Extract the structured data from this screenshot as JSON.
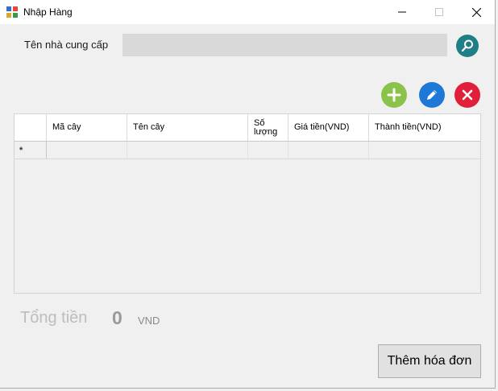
{
  "window": {
    "title": "Nhập Hàng",
    "minimize_glyph": "—",
    "maximize_glyph": "☐",
    "close_glyph": "✕"
  },
  "supplier": {
    "label": "Tên nhà cung cấp",
    "value": "",
    "placeholder": ""
  },
  "toolbar": {
    "search_icon": "search-icon",
    "add_icon": "plus-icon",
    "edit_icon": "pencil-icon",
    "delete_icon": "x-icon",
    "colors": {
      "search": "#1e7f86",
      "add": "#8bc34a",
      "edit": "#1e78d6",
      "delete": "#e0203a"
    }
  },
  "grid": {
    "columns": [
      "Mã cây",
      "Tên cây",
      "Số lượng",
      "Giá tiền(VND)",
      "Thành tiền(VND)"
    ],
    "new_row_marker": "*",
    "rows": []
  },
  "total": {
    "label": "Tổng tiền",
    "value": "0",
    "unit": "VND"
  },
  "submit": {
    "label": "Thêm hóa đơn"
  }
}
